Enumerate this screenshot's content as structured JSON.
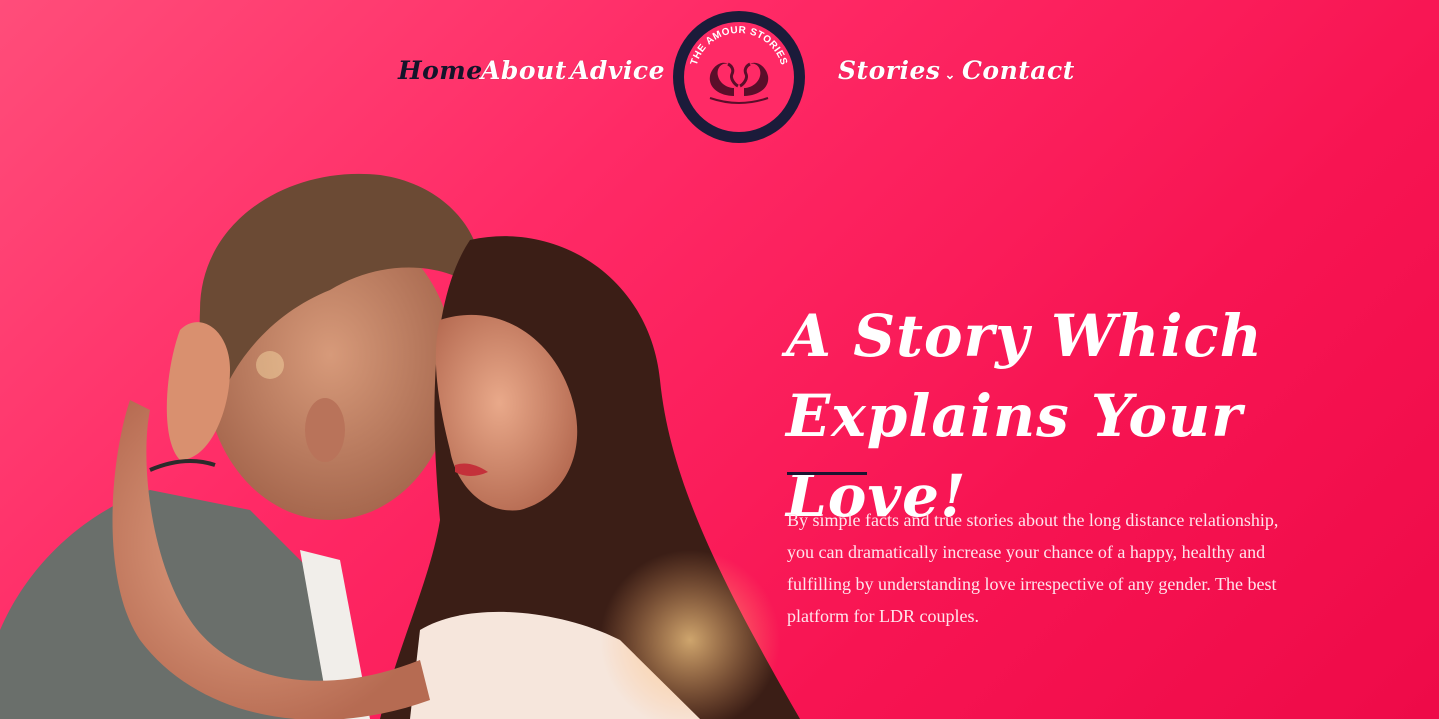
{
  "nav": {
    "items": [
      {
        "label": "Home",
        "active": true
      },
      {
        "label": "About"
      },
      {
        "label": "Advice"
      },
      {
        "label": "Stories",
        "has_dropdown": true
      },
      {
        "label": "Contact"
      }
    ],
    "dropdown_icon": "chevron-down-icon"
  },
  "logo": {
    "text": "THE AMOUR STORIES",
    "icon": "two-swans-heart-icon",
    "colors": {
      "ring": "#1b1b3a",
      "fill": "#ff2a66",
      "swan": "#5a0e2a"
    }
  },
  "hero": {
    "title_line1": "A Story Which",
    "title_line2": "Explains Your Love!",
    "body": "By simple facts and true stories about the long distance relationship, you can dramatically increase your chance of a happy, healthy and fulfilling by understanding love irrespective of any gender. The best platform for LDR couples."
  },
  "colors": {
    "background_start": "#ff4d7a",
    "background_end": "#ee0a48",
    "accent_dark": "#1b1330",
    "text_light": "#ffffff"
  }
}
